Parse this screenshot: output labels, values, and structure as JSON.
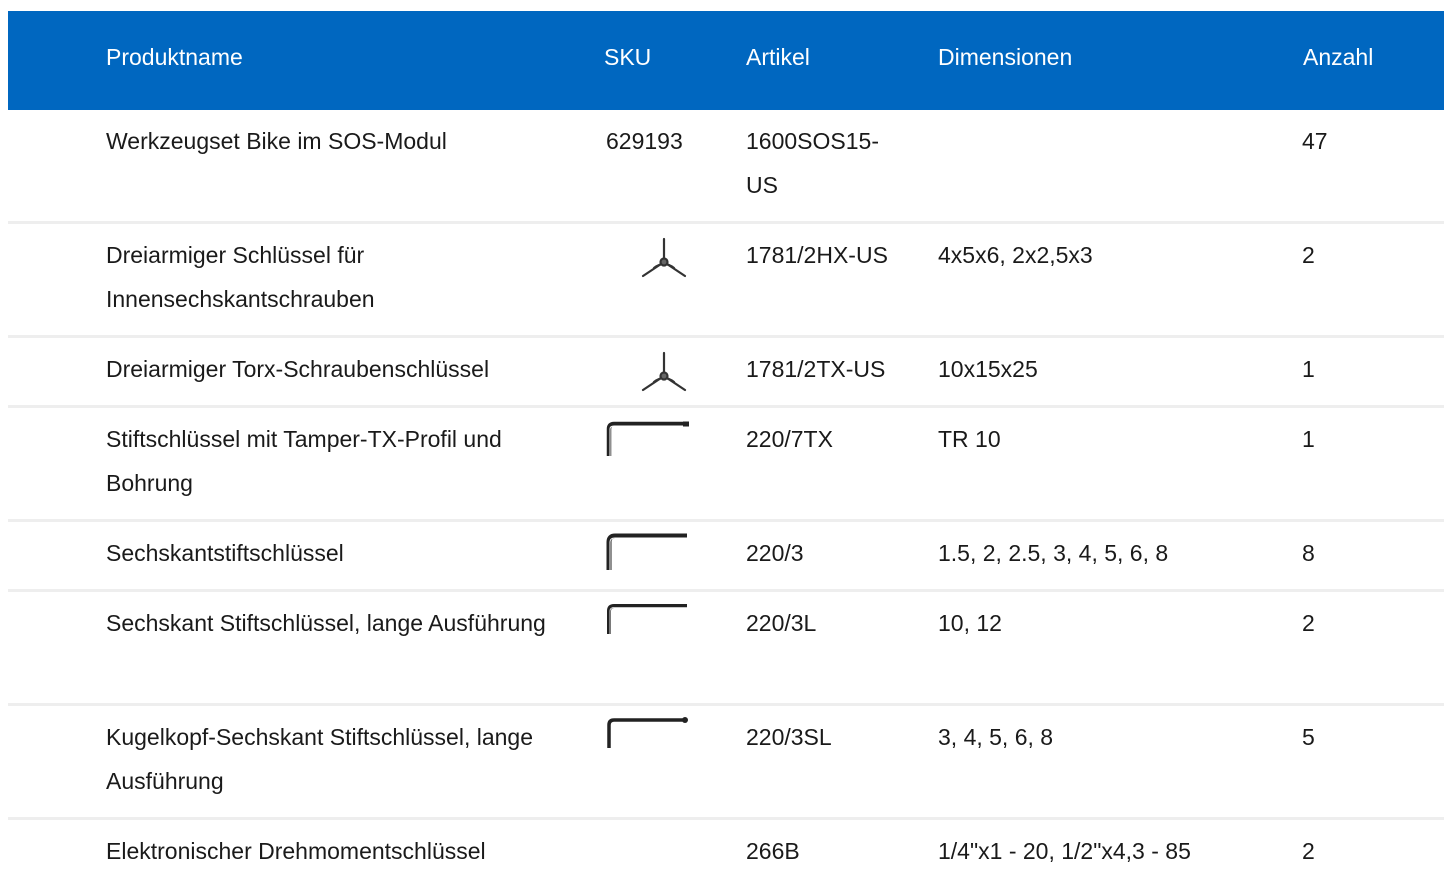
{
  "header": {
    "name": "Produktname",
    "sku": "SKU",
    "article": "Artikel",
    "dimensions": "Dimensionen",
    "count": "Anzahl"
  },
  "rows": [
    {
      "name": "Werkzeugset Bike im SOS-Modul",
      "sku": "629193",
      "sku_icon": "",
      "article": "1600SOS15-US",
      "dimensions": "",
      "count": "47"
    },
    {
      "name": "Dreiarmiger Schlüssel für Innensechskantschrauben",
      "sku": "",
      "sku_icon": "y-wrench-icon",
      "article": "1781/2HX-US",
      "dimensions": "4x5x6, 2x2,5x3",
      "count": "2"
    },
    {
      "name": "Dreiarmiger Torx-Schraubenschlüssel",
      "sku": "",
      "sku_icon": "y-wrench-icon",
      "article": "1781/2TX-US",
      "dimensions": "10x15x25",
      "count": "1"
    },
    {
      "name": "Stiftschlüssel mit Tamper-TX-Profil und Bohrung",
      "sku": "",
      "sku_icon": "l-key-icon",
      "article": "220/7TX",
      "dimensions": "TR 10",
      "count": "1"
    },
    {
      "name": "Sechskantstiftschlüssel",
      "sku": "",
      "sku_icon": "l-key-icon",
      "article": "220/3",
      "dimensions": "1.5, 2, 2.5, 3, 4, 5, 6, 8",
      "count": "8"
    },
    {
      "name": "Sechskant Stiftschlüssel, lange Ausführung",
      "sku": "",
      "sku_icon": "l-key-icon",
      "article": "220/3L",
      "dimensions": "10, 12",
      "count": "2"
    },
    {
      "name": "Kugelkopf-Sechskant Stiftschlüssel, lange Ausführung",
      "sku": "",
      "sku_icon": "ball-end-l-key-icon",
      "article": "220/3SL",
      "dimensions": "3, 4, 5, 6, 8",
      "count": "5"
    },
    {
      "name": "Elektronischer Drehmomentschlüssel",
      "sku": "",
      "sku_icon": "",
      "article": "266B",
      "dimensions": "1/4\"x1 - 20, 1/2\"x4,3 - 85",
      "count": "2"
    }
  ]
}
